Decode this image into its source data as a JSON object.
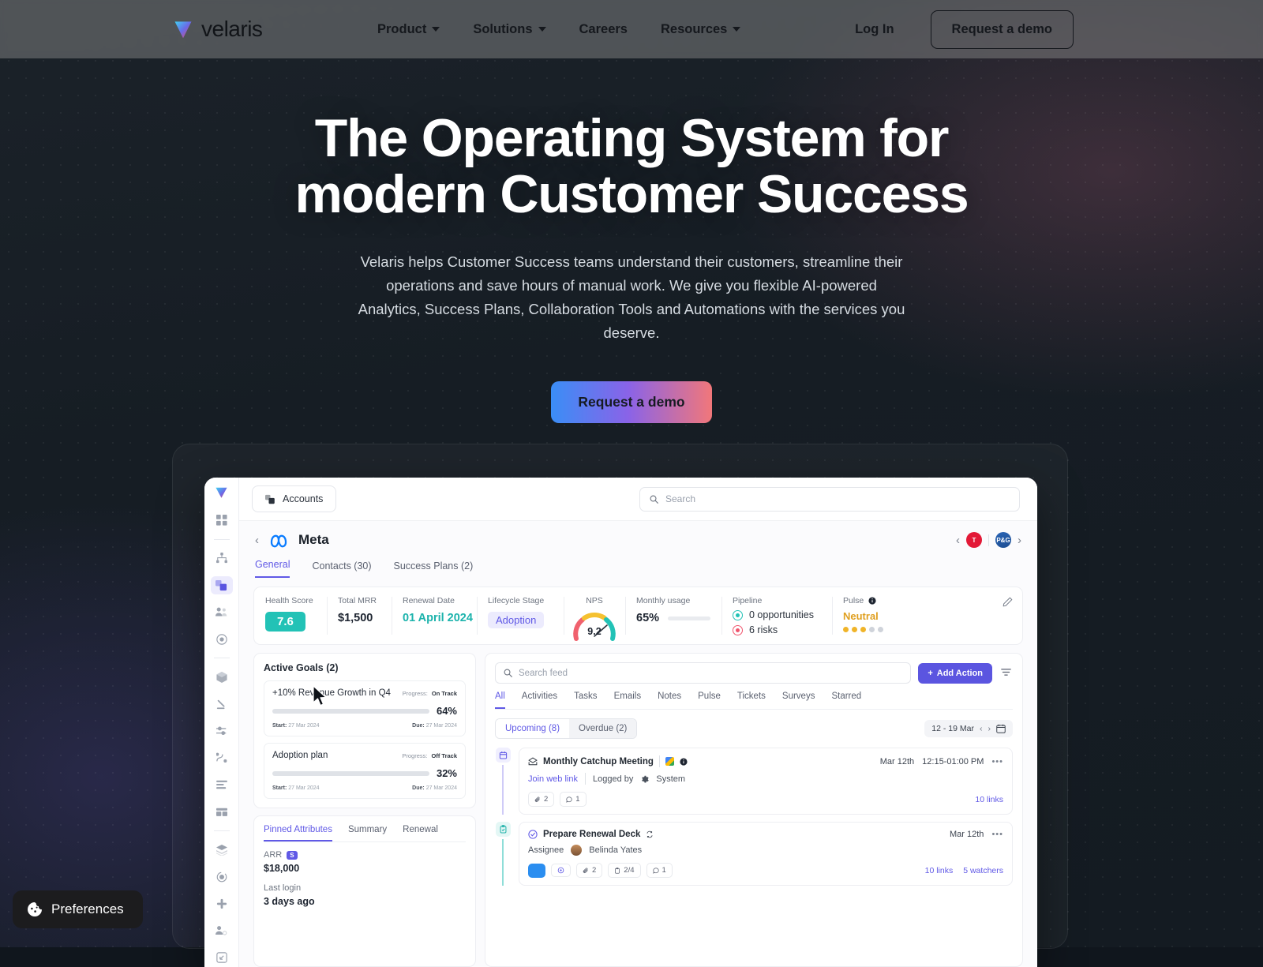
{
  "nav": {
    "brand": "velaris",
    "links": [
      {
        "label": "Product",
        "has_caret": true
      },
      {
        "label": "Solutions",
        "has_caret": true
      },
      {
        "label": "Careers",
        "has_caret": false
      },
      {
        "label": "Resources",
        "has_caret": true
      }
    ],
    "login": "Log In",
    "demo": "Request a demo"
  },
  "hero": {
    "title_line1": "The Operating System for",
    "title_line2": "modern Customer Success",
    "subtitle": "Velaris helps Customer Success teams understand their customers, streamline their operations and save hours of manual work. We give you flexible AI-powered Analytics, Success Plans, Collaboration Tools and Automations with the services you deserve.",
    "cta": "Request a demo"
  },
  "app": {
    "topbar": {
      "accounts_label": "Accounts",
      "search_placeholder": "Search"
    },
    "account": {
      "name": "Meta",
      "tabs": [
        {
          "label": "General",
          "active": true
        },
        {
          "label": "Contacts (30)",
          "active": false
        },
        {
          "label": "Success Plans (2)",
          "active": false
        }
      ],
      "logos": [
        "Tesla",
        "P&G"
      ]
    },
    "metrics": {
      "health_score": {
        "label": "Health Score",
        "value": "7.6",
        "color": "#22c2b6"
      },
      "total_mrr": {
        "label": "Total MRR",
        "value": "$1,500"
      },
      "renewal_date": {
        "label": "Renewal Date",
        "value": "01 April 2024",
        "color": "#1cb3ac"
      },
      "lifecycle_stage": {
        "label": "Lifecycle Stage",
        "value": "Adoption"
      },
      "nps": {
        "label": "NPS",
        "value": "9.2"
      },
      "monthly_usage": {
        "label": "Monthly usage",
        "value": "65%",
        "percent": 65
      },
      "pipeline": {
        "label": "Pipeline",
        "opportunities": "0 opportunities",
        "risks": "6 risks"
      },
      "pulse": {
        "label": "Pulse",
        "value": "Neutral",
        "filled": 3,
        "total": 5,
        "color": "#f0b429"
      }
    },
    "goals": {
      "title": "Active Goals (2)",
      "items": [
        {
          "name": "+10% Revenue Growth in Q4",
          "progress_label": "Progress:",
          "status": "On Track",
          "percent": "64%",
          "percent_value": 64,
          "bar_color": "#22c2b6",
          "start_label": "Start:",
          "start": "27 Mar 2024",
          "due_label": "Due:",
          "due": "27 Mar 2024"
        },
        {
          "name": "Adoption plan",
          "progress_label": "Progress:",
          "status": "Off Track",
          "percent": "32%",
          "percent_value": 32,
          "bar_color": "#f0b429",
          "start_label": "Start:",
          "start": "27 Mar 2024",
          "due_label": "Due:",
          "due": "27 Mar 2024"
        }
      ]
    },
    "attributes": {
      "tabs": [
        {
          "label": "Pinned Attributes",
          "active": true
        },
        {
          "label": "Summary",
          "active": false
        },
        {
          "label": "Renewal",
          "active": false
        }
      ],
      "items": [
        {
          "label": "ARR",
          "badge": "S",
          "value": "$18,000"
        },
        {
          "label": "Last login",
          "badge": "",
          "value": "3 days ago"
        }
      ]
    },
    "feed": {
      "search_placeholder": "Search feed",
      "add_action": "Add Action",
      "tabs": [
        {
          "label": "All",
          "active": true
        },
        {
          "label": "Activities",
          "active": false
        },
        {
          "label": "Tasks",
          "active": false
        },
        {
          "label": "Emails",
          "active": false
        },
        {
          "label": "Notes",
          "active": false
        },
        {
          "label": "Pulse",
          "active": false
        },
        {
          "label": "Tickets",
          "active": false
        },
        {
          "label": "Surveys",
          "active": false
        },
        {
          "label": "Starred",
          "active": false
        }
      ],
      "segments": [
        {
          "label": "Upcoming (8)",
          "active": true
        },
        {
          "label": "Overdue (2)",
          "active": false
        }
      ],
      "date_range": "12 - 19 Mar",
      "items": [
        {
          "title": "Monthly Catchup Meeting",
          "date": "Mar 12th",
          "time": "12:15-01:00 PM",
          "sub_link": "Join web link",
          "sub_logged_by": "Logged by",
          "sub_system": "System",
          "attachments": "2",
          "comments": "1",
          "links": "10 links",
          "watchers": "",
          "gutter_icon": "calendar-icon",
          "accent": "purple"
        },
        {
          "title": "Prepare Renewal Deck",
          "date": "Mar 12th",
          "time": "",
          "assignee_label": "Assignee",
          "assignee": "Belinda Yates",
          "attachments": "2",
          "subtasks": "2/4",
          "comments": "1",
          "links": "10 links",
          "watchers": "5 watchers",
          "gutter_icon": "clipboard-check-icon",
          "accent": "teal"
        }
      ]
    }
  },
  "preferences": {
    "label": "Preferences"
  }
}
